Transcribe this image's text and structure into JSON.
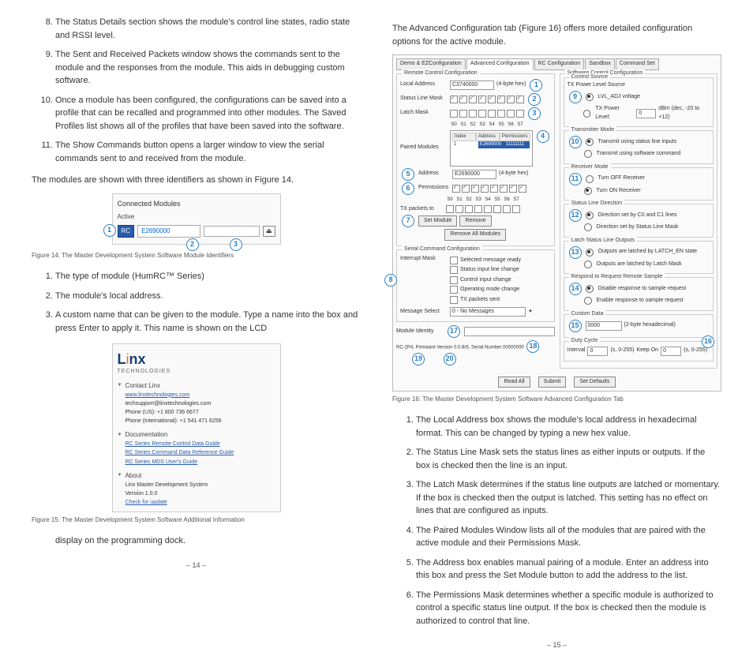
{
  "left": {
    "list": [
      {
        "n": 8,
        "text": "The Status Details section shows the module's control line states, radio state and RSSI level."
      },
      {
        "n": 9,
        "text": "The Sent and Received Packets window shows the commands sent to the module and the responses from the module. This aids in debugging custom software."
      },
      {
        "n": 10,
        "text": "Once a module has been configured, the configurations can be saved into a profile that can be recalled and programmed into other modules. The Saved Profiles list shows all of the profiles that have been saved into the software."
      },
      {
        "n": 11,
        "text": "The Show Commands button opens a larger window to view the serial commands sent to and received from the module."
      }
    ],
    "para1": "The modules are shown with three identifiers as shown in Figure 14.",
    "fig14": {
      "title": "Connected Modules",
      "status": "Active",
      "rc": "RC",
      "addr": "E2690000",
      "caption": "Figure 14: The Master Development System Software Module Identifiers"
    },
    "list2": [
      {
        "n": 1,
        "text": "The type of module (HumRC™ Series)"
      },
      {
        "n": 2,
        "text": "The module's local address."
      },
      {
        "n": 3,
        "text": "A custom name that can be given to the module. Type a name into the box and press Enter to apply it. This name is shown on the LCD"
      }
    ],
    "fig15": {
      "contact_head": "Contact Linx",
      "website": "www.linxtechnologies.com",
      "email": "techsupport@linxtechnologies.com",
      "phone_us": "Phone (US): +1 800 736 6677",
      "phone_intl": "Phone (International): +1 541 471 6256",
      "doc_head": "Documentation",
      "doc1": "RC Series Remote Control Data Guide",
      "doc2": "RC Series Command Data Reference Guide",
      "doc3": "RC Series MDS User's Guide",
      "about_head": "About",
      "about1": "Linx Master Development System",
      "about2": "Version 1.0.0",
      "check": "Check for update",
      "caption": "Figure 15: The Master Development System Software Additional Information"
    },
    "para2": "display on the programming dock.",
    "page": "– 14 –"
  },
  "right": {
    "para1": "The Advanced Configuration tab (Figure 16) offers more detailed configuration options for the active module.",
    "fig16": {
      "tabs": [
        "Demo & EZConfiguration",
        "Advanced Configuration",
        "RC Configuration",
        "Sandbox",
        "Command Set"
      ],
      "active_tab": 1,
      "remote_head": "Remote Control Configuration",
      "local_addr_lbl": "Local Address",
      "local_addr_val": "C3740000",
      "hex_suffix": "(4-byte hex)",
      "status_mask_lbl": "Status Line Mask",
      "latch_mask_lbl": "Latch Mask",
      "line_labels": [
        "S0",
        "S1",
        "S2",
        "S3",
        "S4",
        "S5",
        "S6",
        "S7"
      ],
      "paired_lbl": "Paired Modules",
      "list_hdr": [
        "Index",
        "Address",
        "Permissions"
      ],
      "list_row": [
        "1",
        "E2690000",
        "11111111"
      ],
      "addr_lbl": "Address",
      "addr_val": "E2690000",
      "perm_lbl": "Permissions",
      "tx_lbl": "TX packets to",
      "set_module_btn": "Set Module",
      "remove_btn": "Remove",
      "remove_all_btn": "Remove All Modules",
      "serial_head": "Serial Command Configuration",
      "int_mask_lbl": "Interrupt Mask",
      "int_opts": [
        "Selected message ready",
        "Status input line change",
        "Control input change",
        "Operating mode change",
        "TX packets sent"
      ],
      "msg_select_lbl": "Message Select",
      "msg_select_val": "0 - No Messages",
      "module_identity_lbl": "Module Identity",
      "footer_line": "RC-2P4, Firmware Version 0.0.8r5, Serial Number 00000000",
      "sw_head": "Software Control Configuration",
      "csrc_head": "Control Source",
      "tx_src_lbl": "TX Power Level Source",
      "tx_src_opt1": "LVL_ADJ voltage",
      "tx_src_opt2": "TX Power Level:",
      "tx_pwr_val": "0",
      "dbm": "dBm (dec, -20 to +12)",
      "txmode_head": "Transmitter Mode",
      "txmode_opt1": "Transmit using status line inputs",
      "txmode_opt2": "Transmit using software command",
      "rxmode_head": "Receiver Mode",
      "rxmode_opt1": "Turn OFF Receiver",
      "rxmode_opt2": "Turn ON Receiver",
      "sldir_head": "Status Line Direction",
      "sldir_opt1": "Direction set by C0 and C1 lines",
      "sldir_opt2": "Direction set by Status Line Mask",
      "latch_head": "Latch Status Line Outputs",
      "latch_opt1": "Outputs are latched by LATCH_EN state",
      "latch_opt2": "Outputs are latched by Latch Mask",
      "resp_head": "Respond to Request Remote Sample",
      "resp_opt1": "Disable response to sample request",
      "resp_opt2": "Enable response to sample request",
      "custom_head": "Custom Data",
      "custom_val": "0000",
      "custom_suffix": "(2-byte hexadecimal)",
      "duty_head": "Duty Cycle",
      "interval_lbl": "Interval",
      "interval_val": "0",
      "unit1": "(s, 0-255)",
      "keepon_lbl": "Keep On",
      "keepon_val": "0",
      "read_btn": "Read All",
      "submit_btn": "Submit",
      "defaults_btn": "Set Defaults",
      "caption": "Figure 16: The Master Development System Software Advanced Configuration Tab"
    },
    "list": [
      {
        "n": 1,
        "text": "The Local Address box shows the module's local address in hexadecimal format. This can be changed by typing a new hex value."
      },
      {
        "n": 2,
        "text": "The Status Line Mask sets the status lines as either inputs or outputs. If the box is checked then the line is an input."
      },
      {
        "n": 3,
        "text": "The Latch Mask determines if the status line outputs are latched or momentary. If the box is checked then the output is latched. This setting has no effect on lines that are configured as inputs."
      },
      {
        "n": 4,
        "text": "The Paired Modules Window lists all of the modules that are paired with the active module and their Permissions Mask."
      },
      {
        "n": 5,
        "text": "The Address box enables manual pairing of a module. Enter an address into this box and press the Set Module button to add the address to the list."
      },
      {
        "n": 6,
        "text": "The Permissions Mask determines whether a specific module is authorized to control a specific status line output. If the box is checked then the module is authorized to control that line."
      }
    ],
    "page": "– 15 –"
  }
}
